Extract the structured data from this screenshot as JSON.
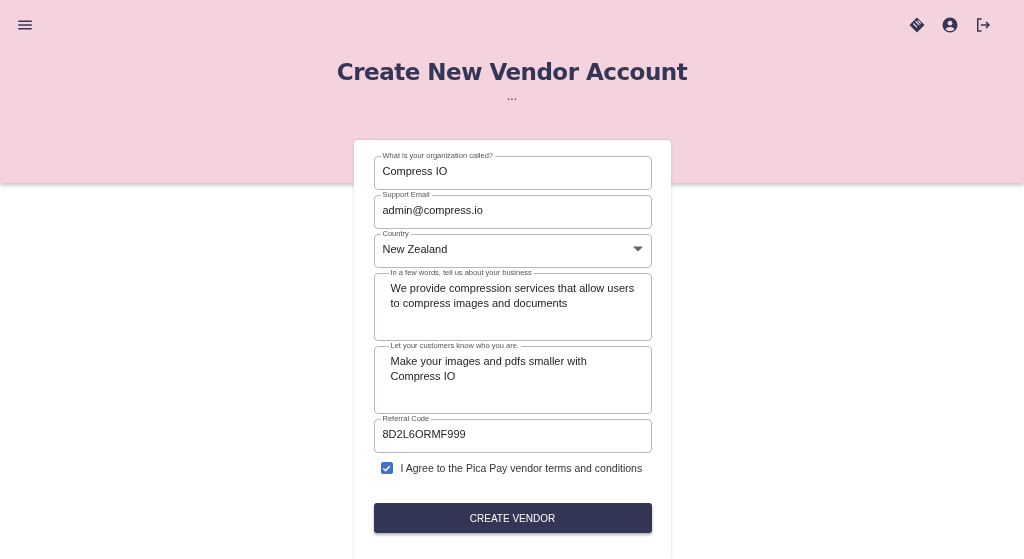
{
  "header": {
    "title": "Create New Vendor Account",
    "subtitle": "..."
  },
  "form": {
    "fields": [
      {
        "kind": "text",
        "label": "What is your organization called?",
        "value": "Compress IO"
      },
      {
        "kind": "text",
        "label": "Support Email",
        "value": "admin@compress.io"
      },
      {
        "kind": "select",
        "label": "Country",
        "value": "New Zealand"
      },
      {
        "kind": "textarea",
        "label": "In a few words, tell us about your business",
        "value": "We provide compression services that allow users to compress images and documents"
      },
      {
        "kind": "textarea",
        "label": "Let your customers know who you are.",
        "value": "Make your images and pdfs smaller with Compress IO"
      },
      {
        "kind": "text",
        "label": "Referral Code",
        "value": "8D2L6ORMF999"
      }
    ],
    "agreement": {
      "label": "I Agree to the Pica Pay vendor terms and conditions",
      "checked": true
    },
    "submit": "CREATE VENDOR"
  }
}
